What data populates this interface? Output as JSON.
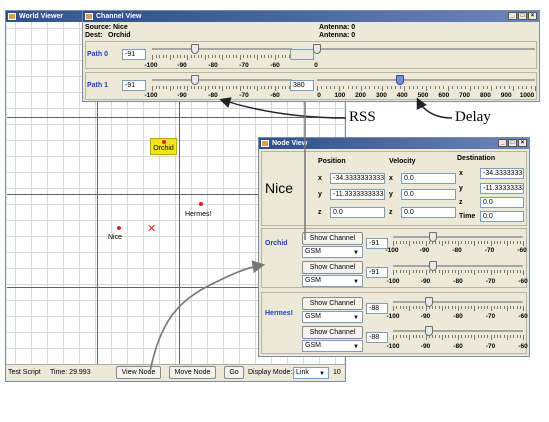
{
  "world_viewer": {
    "title": "World Viewer",
    "nodes": [
      {
        "label": "Orchid",
        "highlighted": true
      },
      {
        "label": "Hermes!",
        "highlighted": false
      },
      {
        "label": "Nice",
        "highlighted": false
      }
    ],
    "status": {
      "script_label": "Test Script",
      "time_label": "Time: 29.993",
      "view_node": "View Node",
      "move_node": "Move Node",
      "go": "Go",
      "display_mode_label": "Display Mode:",
      "display_mode_value": "Link",
      "extra": "10"
    }
  },
  "channel_view": {
    "title": "Channel View",
    "source_label": "Source: Nice",
    "dest_label": "Dest:",
    "dest_value": "Orchid",
    "antenna_src": "Antenna: 0",
    "antenna_dst": "Antenna: 0",
    "paths": [
      {
        "label": "Path 0",
        "rss_value": "-91",
        "rss_fraction": 0.31,
        "delay_value": "",
        "delay_fraction": 0.0
      },
      {
        "label": "Path 1",
        "rss_value": "-91",
        "rss_fraction": 0.31,
        "delay_value": "380",
        "delay_fraction": 0.38
      }
    ],
    "rss_ticks": [
      "-100",
      "-90",
      "-80",
      "-70",
      "-60"
    ],
    "rss_axis_end": "0",
    "delay_ticks": [
      "0",
      "100",
      "200",
      "300",
      "400",
      "500",
      "600",
      "700",
      "800",
      "900",
      "1000"
    ]
  },
  "node_view": {
    "title": "Node View",
    "node_name": "Nice",
    "position_header": "Position",
    "velocity_header": "Velocity",
    "destination_header": "Destination",
    "position": {
      "x": "-34.3333333333",
      "y": "-11.3333333333",
      "z": "0.0"
    },
    "velocity": {
      "x": "0.0",
      "y": "0.0",
      "z": "0.0"
    },
    "destination": {
      "x": "-34.33333333",
      "y": "-11.33333333",
      "z": "0.0",
      "time": "0.0"
    },
    "axis_labels": {
      "x": "x",
      "y": "y",
      "z": "z",
      "time": "Time"
    },
    "channels": [
      {
        "peer": "Orchid",
        "rows": [
          {
            "button": "Show Channel",
            "protocol": "GSM",
            "rss": "-91",
            "fraction": 0.31
          },
          {
            "button": "Show Channel",
            "protocol": "GSM",
            "rss": "-91",
            "fraction": 0.31
          }
        ]
      },
      {
        "peer": "Hermes!",
        "rows": [
          {
            "button": "Show Channel",
            "protocol": "GSM",
            "rss": "-88",
            "fraction": 0.28
          },
          {
            "button": "Show Channel",
            "protocol": "GSM",
            "rss": "-88",
            "fraction": 0.28
          }
        ]
      }
    ],
    "rss_ticks": [
      "-100",
      "-90",
      "-80",
      "-70",
      "-60"
    ]
  },
  "annotations": {
    "rss": "RSS",
    "delay": "Delay"
  }
}
